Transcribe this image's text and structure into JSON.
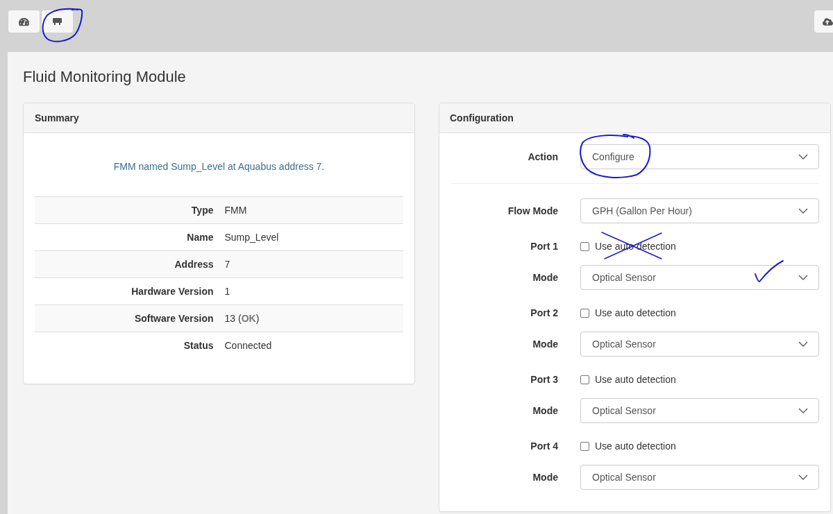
{
  "toolbar_buttons": [
    {
      "circled": false
    },
    {
      "circled": true
    }
  ],
  "page_title": "Fluid Monitoring Module",
  "summary": {
    "title": "Summary",
    "message": "FMM named Sump_Level at Aquabus address 7.",
    "rows": [
      {
        "label": "Type",
        "value": "FMM"
      },
      {
        "label": "Name",
        "value": "Sump_Level"
      },
      {
        "label": "Address",
        "value": "7"
      },
      {
        "label": "Hardware Version",
        "value": "1"
      },
      {
        "label": "Software Version",
        "value": "13 (**OK**)"
      },
      {
        "label": "Status",
        "value": "Connected"
      }
    ]
  },
  "configuration": {
    "title": "Configuration",
    "action": {
      "label": "Action",
      "value": "Configure",
      "circled": true
    },
    "flow_mode": {
      "label": "Flow Mode",
      "value": "GPH (Gallon Per Hour)"
    },
    "ports": [
      {
        "label": "Port 1",
        "auto_detection": {
          "label": "Use auto detection",
          "checked": false,
          "crossed_out": true
        },
        "mode": {
          "label": "Mode",
          "value": "Optical Sensor",
          "ticked": true
        }
      },
      {
        "label": "Port 2",
        "auto_detection": {
          "label": "Use auto detection",
          "checked": false,
          "crossed_out": false
        },
        "mode": {
          "label": "Mode",
          "value": "Optical Sensor",
          "ticked": false
        }
      },
      {
        "label": "Port 3",
        "auto_detection": {
          "label": "Use auto detection",
          "checked": false,
          "crossed_out": false
        },
        "mode": {
          "label": "Mode",
          "value": "Optical Sensor",
          "ticked": false
        }
      },
      {
        "label": "Port 4",
        "auto_detection": {
          "label": "Use auto detection",
          "checked": false,
          "crossed_out": false
        },
        "mode": {
          "label": "Mode",
          "value": "Optical Sensor",
          "ticked": false
        }
      }
    ]
  }
}
